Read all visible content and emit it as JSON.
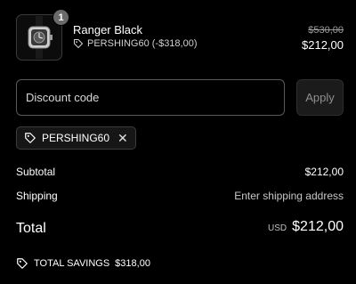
{
  "product": {
    "quantity": "1",
    "name": "Ranger Black",
    "discount_label": "PERSHING60 (-$318,00)",
    "price_original": "$530,00",
    "price_current": "$212,00"
  },
  "discount": {
    "placeholder": "Discount code",
    "apply_label": "Apply",
    "applied_code": "PERSHING60"
  },
  "summary": {
    "subtotal_label": "Subtotal",
    "subtotal_value": "$212,00",
    "shipping_label": "Shipping",
    "shipping_value": "Enter shipping address",
    "total_label": "Total",
    "total_currency": "USD",
    "total_value": "$212,00",
    "savings_label": "TOTAL SAVINGS",
    "savings_value": "$318,00"
  }
}
